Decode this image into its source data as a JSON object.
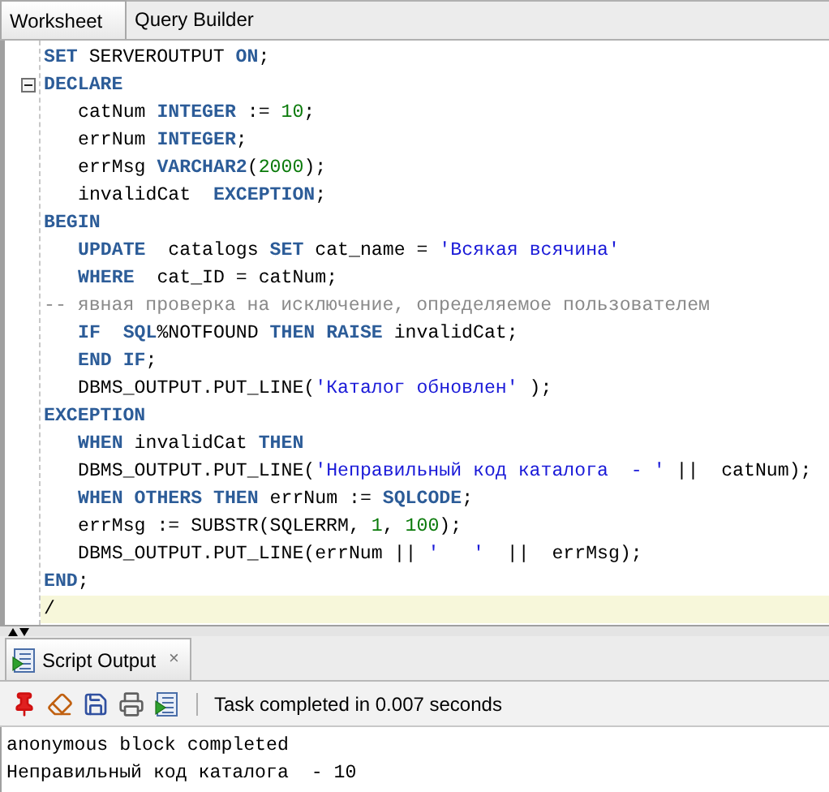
{
  "editor_tabs": [
    {
      "label": "Worksheet",
      "selected": true
    },
    {
      "label": "Query Builder",
      "selected": false
    }
  ],
  "code_lines": [
    {
      "current": false,
      "indented": false,
      "tokens": [
        {
          "kind": "keyword",
          "text": "SET"
        },
        {
          "kind": "plain",
          "text": " SERVEROUTPUT "
        },
        {
          "kind": "keyword",
          "text": "ON"
        },
        {
          "kind": "plain",
          "text": ";"
        }
      ]
    },
    {
      "current": false,
      "indented": false,
      "folded": false,
      "tokens": [
        {
          "kind": "keyword",
          "text": "DECLARE"
        }
      ]
    },
    {
      "current": false,
      "indented": true,
      "tokens": [
        {
          "kind": "plain",
          "text": "catNum "
        },
        {
          "kind": "keyword",
          "text": "INTEGER"
        },
        {
          "kind": "plain",
          "text": " := "
        },
        {
          "kind": "number",
          "text": "10"
        },
        {
          "kind": "plain",
          "text": ";"
        }
      ]
    },
    {
      "current": false,
      "indented": true,
      "tokens": [
        {
          "kind": "plain",
          "text": "errNum "
        },
        {
          "kind": "keyword",
          "text": "INTEGER"
        },
        {
          "kind": "plain",
          "text": ";"
        }
      ]
    },
    {
      "current": false,
      "indented": true,
      "tokens": [
        {
          "kind": "plain",
          "text": "errMsg "
        },
        {
          "kind": "keyword",
          "text": "VARCHAR2"
        },
        {
          "kind": "plain",
          "text": "("
        },
        {
          "kind": "number",
          "text": "2000"
        },
        {
          "kind": "plain",
          "text": ");"
        }
      ]
    },
    {
      "current": false,
      "indented": true,
      "tokens": [
        {
          "kind": "plain",
          "text": "invalidCat  "
        },
        {
          "kind": "keyword",
          "text": "EXCEPTION"
        },
        {
          "kind": "plain",
          "text": ";"
        }
      ]
    },
    {
      "current": false,
      "indented": false,
      "tokens": [
        {
          "kind": "keyword",
          "text": "BEGIN"
        }
      ]
    },
    {
      "current": false,
      "indented": true,
      "tokens": [
        {
          "kind": "keyword",
          "text": "UPDATE"
        },
        {
          "kind": "plain",
          "text": "  catalogs "
        },
        {
          "kind": "keyword",
          "text": "SET"
        },
        {
          "kind": "plain",
          "text": " cat_name = "
        },
        {
          "kind": "string",
          "text": "'Всякая всячина'"
        }
      ]
    },
    {
      "current": false,
      "indented": true,
      "tokens": [
        {
          "kind": "keyword",
          "text": "WHERE"
        },
        {
          "kind": "plain",
          "text": "  cat_ID = catNum;"
        }
      ]
    },
    {
      "current": false,
      "indented": false,
      "tokens": [
        {
          "kind": "comment",
          "text": "-- явная проверка на исключение, определяемое пользователем"
        }
      ]
    },
    {
      "current": false,
      "indented": true,
      "tokens": [
        {
          "kind": "keyword",
          "text": "IF  SQL"
        },
        {
          "kind": "plain",
          "text": "%NOTFOUND "
        },
        {
          "kind": "keyword",
          "text": "THEN RAISE"
        },
        {
          "kind": "plain",
          "text": " invalidCat;"
        }
      ]
    },
    {
      "current": false,
      "indented": true,
      "tokens": [
        {
          "kind": "keyword",
          "text": "END IF"
        },
        {
          "kind": "plain",
          "text": ";"
        }
      ]
    },
    {
      "current": false,
      "indented": true,
      "tokens": [
        {
          "kind": "plain",
          "text": "DBMS_OUTPUT.PUT_LINE("
        },
        {
          "kind": "string",
          "text": "'Каталог обновлен'"
        },
        {
          "kind": "plain",
          "text": " );"
        }
      ]
    },
    {
      "current": false,
      "indented": false,
      "tokens": [
        {
          "kind": "keyword",
          "text": "EXCEPTION"
        }
      ]
    },
    {
      "current": false,
      "indented": true,
      "tokens": [
        {
          "kind": "keyword",
          "text": "WHEN"
        },
        {
          "kind": "plain",
          "text": " invalidCat "
        },
        {
          "kind": "keyword",
          "text": "THEN"
        }
      ]
    },
    {
      "current": false,
      "indented": true,
      "tokens": [
        {
          "kind": "plain",
          "text": "DBMS_OUTPUT.PUT_LINE("
        },
        {
          "kind": "string",
          "text": "'Неправильный код каталога  - '"
        },
        {
          "kind": "plain",
          "text": " ||  catNum);"
        }
      ]
    },
    {
      "current": false,
      "indented": true,
      "tokens": [
        {
          "kind": "keyword",
          "text": "WHEN OTHERS THEN"
        },
        {
          "kind": "plain",
          "text": " errNum := "
        },
        {
          "kind": "keyword",
          "text": "SQLCODE"
        },
        {
          "kind": "plain",
          "text": ";"
        }
      ]
    },
    {
      "current": false,
      "indented": true,
      "tokens": [
        {
          "kind": "plain",
          "text": "errMsg := SUBSTR(SQLERRM, "
        },
        {
          "kind": "number",
          "text": "1"
        },
        {
          "kind": "plain",
          "text": ", "
        },
        {
          "kind": "number",
          "text": "100"
        },
        {
          "kind": "plain",
          "text": ");"
        }
      ]
    },
    {
      "current": false,
      "indented": true,
      "tokens": [
        {
          "kind": "plain",
          "text": "DBMS_OUTPUT.PUT_LINE(errNum || "
        },
        {
          "kind": "string",
          "text": "'   '"
        },
        {
          "kind": "plain",
          "text": "  ||  errMsg);"
        }
      ]
    },
    {
      "current": false,
      "indented": false,
      "tokens": [
        {
          "kind": "keyword",
          "text": "END"
        },
        {
          "kind": "plain",
          "text": ";"
        }
      ]
    },
    {
      "current": true,
      "indented": false,
      "tokens": [
        {
          "kind": "plain",
          "text": "/"
        }
      ]
    }
  ],
  "output_panel": {
    "tab": {
      "label": "Script Output",
      "selected": true,
      "close": "×"
    },
    "status": "Task completed in 0.007 seconds",
    "lines": [
      "anonymous block completed",
      "Неправильный код каталога  - 10"
    ]
  }
}
